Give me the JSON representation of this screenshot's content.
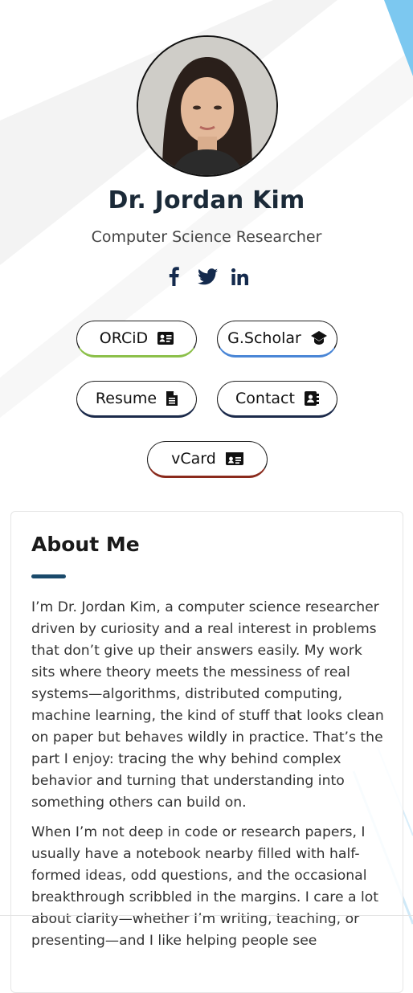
{
  "profile": {
    "name": "Dr. Jordan Kim",
    "title": "Computer Science Researcher"
  },
  "social_links": [
    {
      "icon": "facebook-icon"
    },
    {
      "icon": "twitter-icon"
    },
    {
      "icon": "linkedin-icon"
    }
  ],
  "buttons": {
    "orcid": {
      "label": "ORCiD",
      "icon": "id-card-icon",
      "accent": "#8cc04a"
    },
    "scholar": {
      "label": "G.Scholar",
      "icon": "graduation-cap-icon",
      "accent": "#4a86d6"
    },
    "resume": {
      "label": "Resume",
      "icon": "document-icon",
      "accent": "#1b2a4a"
    },
    "contact": {
      "label": "Contact",
      "icon": "address-book-icon",
      "accent": "#1b2a4a"
    },
    "vcard": {
      "label": "vCard",
      "icon": "vcard-icon",
      "accent": "#8a2a1c"
    }
  },
  "about": {
    "heading": "About Me",
    "paragraphs": [
      "I’m Dr. Jordan Kim, a computer science researcher driven by curiosity and a real interest in problems that don’t give up their answers easily. My work sits where theory meets the messiness of real systems—algorithms, distributed computing, machine learning, the kind of stuff that looks clean on paper but behaves wildly in practice. That’s the part I enjoy: tracing the why behind complex behavior and turning that understanding into something others can build on.",
      "When I’m not deep in code or research papers, I usually have a notebook nearby filled with half-formed ideas, odd questions, and the occasional breakthrough scribbled in the margins. I care a lot about clarity—whether I’m writing, teaching, or presenting—and I like helping people see"
    ]
  },
  "colors": {
    "heading": "#1b2a38",
    "accent_rule": "#1a4a6b",
    "decor_blue": "#7cc8f0"
  }
}
